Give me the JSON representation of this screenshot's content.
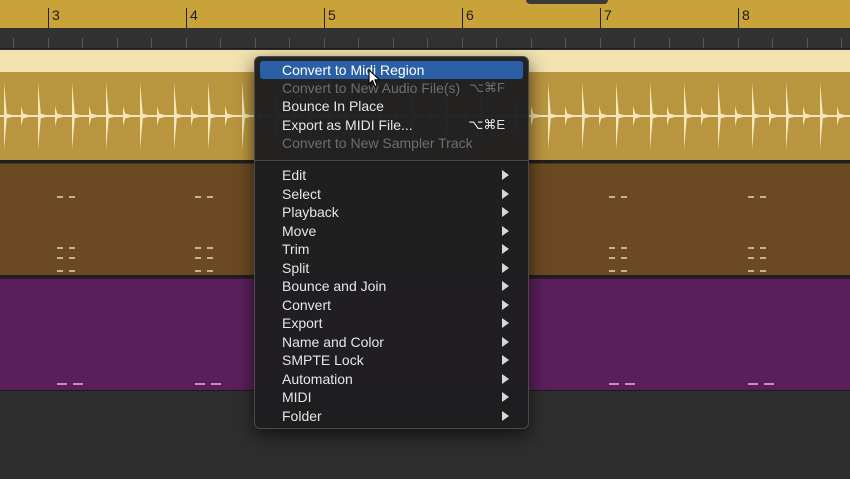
{
  "ruler": {
    "bars": [
      "3",
      "4",
      "5",
      "6",
      "7",
      "8"
    ]
  },
  "tracks": [
    {
      "name": "audio-region",
      "color": "#b9953f"
    },
    {
      "name": "midi-region-brown",
      "color": "#6b4a23"
    },
    {
      "name": "midi-region-purple",
      "color": "#5a1f5b"
    }
  ],
  "menu": {
    "items": [
      {
        "label": "Convert to Midi Region",
        "highlighted": true
      },
      {
        "label": "Convert to New Audio File(s)",
        "shortcut": "⌥⌘F",
        "disabled": true
      },
      {
        "label": "Bounce In Place"
      },
      {
        "label": "Export as MIDI File...",
        "shortcut": "⌥⌘E"
      },
      {
        "label": "Convert to New Sampler Track",
        "disabled": true
      }
    ],
    "submenus": [
      {
        "label": "Edit"
      },
      {
        "label": "Select"
      },
      {
        "label": "Playback"
      },
      {
        "label": "Move"
      },
      {
        "label": "Trim"
      },
      {
        "label": "Split"
      },
      {
        "label": "Bounce and Join"
      },
      {
        "label": "Convert"
      },
      {
        "label": "Export"
      },
      {
        "label": "Name and Color"
      },
      {
        "label": "SMPTE Lock"
      },
      {
        "label": "Automation"
      },
      {
        "label": "MIDI"
      },
      {
        "label": "Folder"
      }
    ]
  }
}
